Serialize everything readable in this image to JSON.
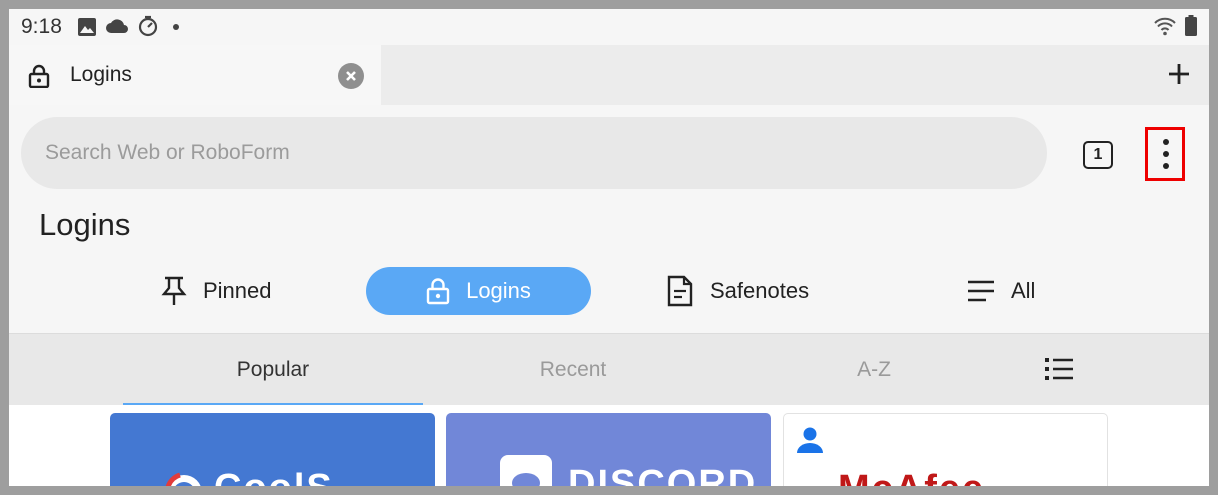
{
  "status_bar": {
    "time": "9:18",
    "left_icons": [
      "image-icon",
      "cloud-icon",
      "timer-icon",
      "dot-icon"
    ],
    "right_icons": [
      "wifi-icon",
      "battery-icon"
    ]
  },
  "tab": {
    "title": "Logins"
  },
  "search": {
    "placeholder": "Search Web or RoboForm"
  },
  "tab_count": "1",
  "page_title": "Logins",
  "categories": [
    {
      "label": "Pinned",
      "icon": "pin-icon"
    },
    {
      "label": "Logins",
      "icon": "lock-icon",
      "active": true
    },
    {
      "label": "Safenotes",
      "icon": "note-icon"
    },
    {
      "label": "All",
      "icon": "list-icon"
    }
  ],
  "sort_tabs": [
    {
      "label": "Popular",
      "active": true
    },
    {
      "label": "Recent"
    },
    {
      "label": "A-Z"
    }
  ],
  "cards": [
    {
      "name": "CoolSculpting",
      "logo_text": "CoolS",
      "color": "#4478d2"
    },
    {
      "name": "Discord",
      "logo_text": "DISCORD",
      "color": "#7187d8"
    },
    {
      "name": "McAfee",
      "logo_text": "McAfee",
      "color": "#c01818"
    }
  ],
  "colors": {
    "accent": "#5aa8f5",
    "highlight_border": "#ee0000"
  }
}
